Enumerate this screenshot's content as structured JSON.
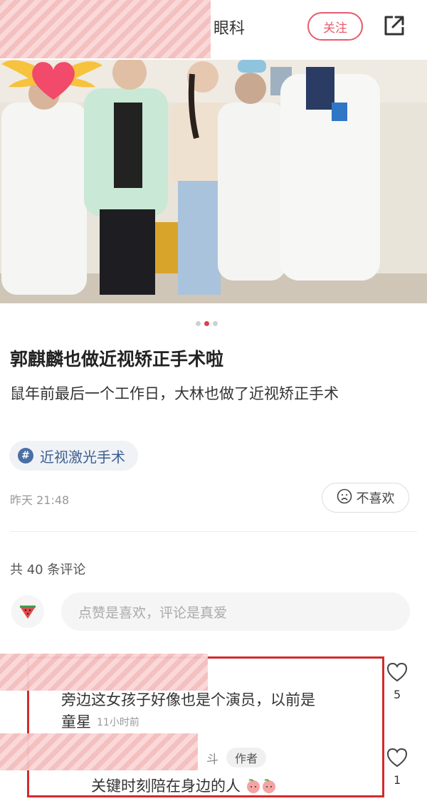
{
  "header": {
    "title": "眼科",
    "follow_label": "关注"
  },
  "post": {
    "carousel": {
      "total": 3,
      "active": 2
    },
    "title": "郭麒麟也做近视矫正手术啦",
    "body": "鼠年前最后一个工作日，大林也做了近视矫正手术",
    "tag": "近视激光手术",
    "time": "昨天 21:48",
    "dislike_label": "不喜欢"
  },
  "comments": {
    "count_label": "共 40 条评论",
    "input_placeholder": "点赞是喜欢，评论是真爱",
    "items": [
      {
        "text_line1": "旁边这女孩子好像也是个演员，以前是",
        "text_line2": "童星",
        "time": "11小时前",
        "likes": "5"
      },
      {
        "name_tail": "斗",
        "author_badge": "作者",
        "text": "关键时刻陪在身边的人",
        "likes": "1"
      }
    ]
  },
  "colors": {
    "accent": "#e85b6d",
    "highlight_box": "#d42a2a",
    "tag_text": "#3c5f90"
  },
  "icons": [
    "share-icon",
    "hashtag-icon",
    "dislike-face-icon",
    "watermelon-icon",
    "heart-outline-icon",
    "peach-emoji-icon"
  ]
}
